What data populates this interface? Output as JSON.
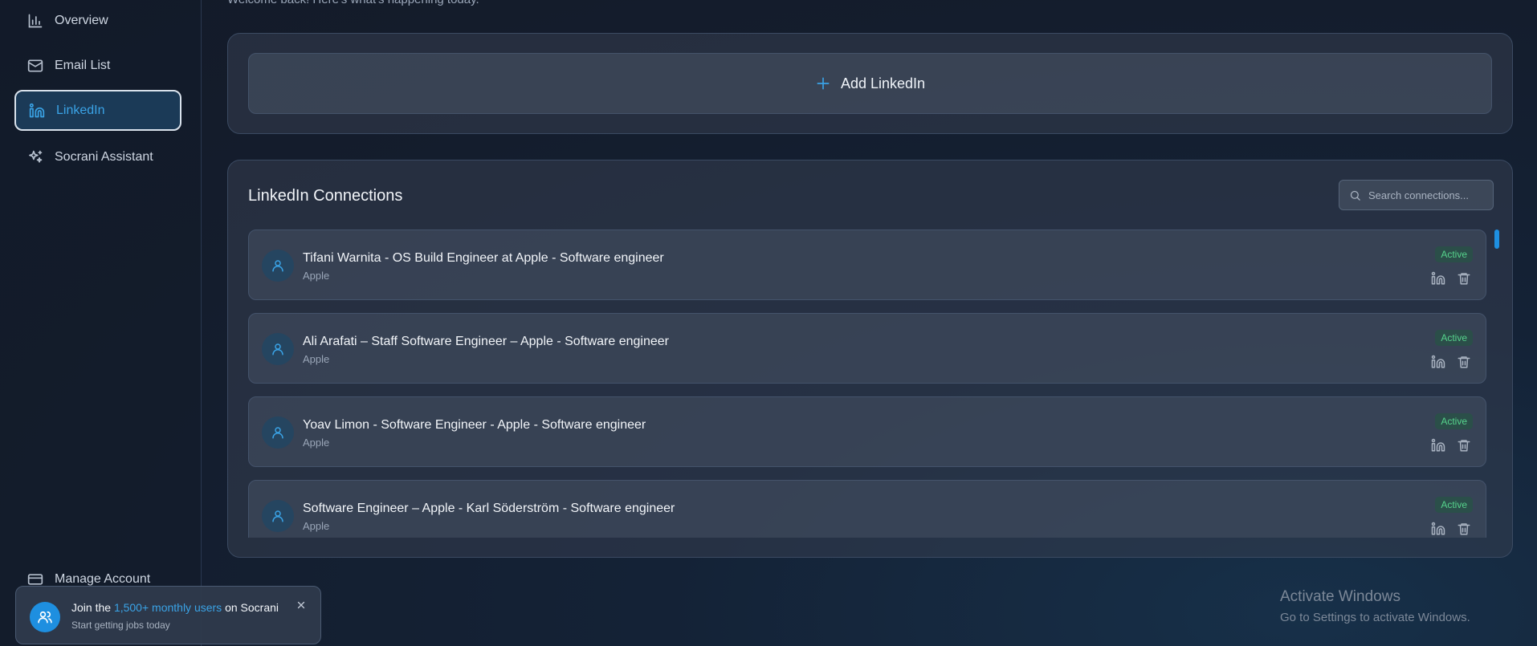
{
  "welcome": "Welcome back! Here's what's happening today.",
  "sidebar": {
    "items": [
      {
        "label": "Overview",
        "icon": "bar-chart-icon"
      },
      {
        "label": "Email List",
        "icon": "mail-icon"
      },
      {
        "label": "LinkedIn",
        "icon": "linkedin-icon",
        "active": true
      },
      {
        "label": "Socrani Assistant",
        "icon": "sparkles-icon"
      }
    ],
    "manage_account": "Manage Account"
  },
  "add_linkedin": {
    "label": "Add LinkedIn",
    "icon": "plus-icon"
  },
  "connections": {
    "title": "LinkedIn Connections",
    "search_placeholder": "Search connections...",
    "rows": [
      {
        "name": "Tifani Warnita - OS Build Engineer at Apple - Software engineer",
        "company": "Apple",
        "status": "Active"
      },
      {
        "name": "Ali Arafati – Staff Software Engineer – Apple - Software engineer",
        "company": "Apple",
        "status": "Active"
      },
      {
        "name": "Yoav Limon - Software Engineer - Apple - Software engineer",
        "company": "Apple",
        "status": "Active"
      },
      {
        "name": "Software Engineer – Apple - Karl Söderström - Software engineer",
        "company": "Apple",
        "status": "Active"
      }
    ]
  },
  "toast": {
    "prefix": "Join the",
    "highlight": "1,500+ monthly users",
    "suffix": "on Socrani",
    "subtitle": "Start getting jobs today"
  },
  "windows_watermark": {
    "title": "Activate Windows",
    "subtitle": "Go to Settings to activate Windows."
  },
  "colors": {
    "accent": "#3aa3e6",
    "active_status": "#56d38c",
    "background": "#141d2d"
  }
}
